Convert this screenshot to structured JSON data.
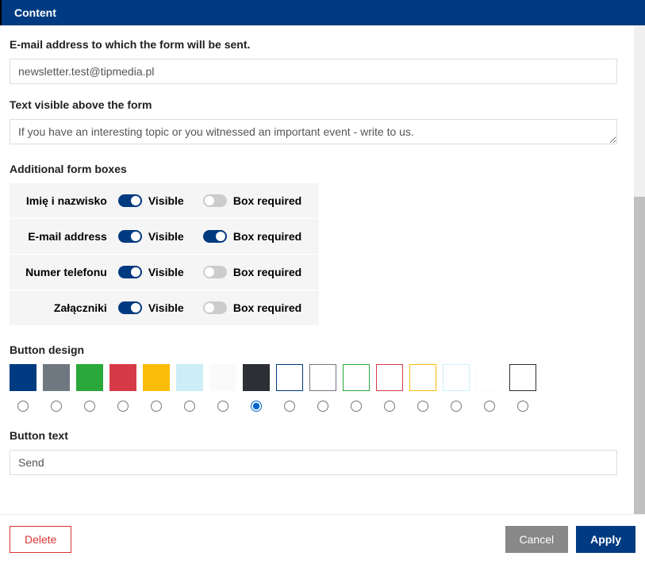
{
  "header": {
    "title": "Content"
  },
  "email_field": {
    "label": "E-mail address to which the form will be sent.",
    "value": "newsletter.test@tipmedia.pl"
  },
  "text_above": {
    "label": "Text visible above the form",
    "value": "If you have an interesting topic or you witnessed an important event - write to us."
  },
  "form_boxes": {
    "label": "Additional form boxes",
    "visible_label": "Visible",
    "required_label": "Box required",
    "rows": [
      {
        "name": "Imię i nazwisko",
        "visible": true,
        "required": false
      },
      {
        "name": "E-mail address",
        "visible": true,
        "required": true
      },
      {
        "name": "Numer telefonu",
        "visible": true,
        "required": false
      },
      {
        "name": "Załączniki",
        "visible": true,
        "required": false
      }
    ]
  },
  "button_design": {
    "label": "Button design",
    "selected_index": 7,
    "colors": [
      {
        "type": "solid",
        "color": "#003a80"
      },
      {
        "type": "solid",
        "color": "#6f7880"
      },
      {
        "type": "solid",
        "color": "#2aa839"
      },
      {
        "type": "solid",
        "color": "#d63a48"
      },
      {
        "type": "solid",
        "color": "#fbbd0a"
      },
      {
        "type": "solid",
        "color": "#cdeef7"
      },
      {
        "type": "solid",
        "color": "#fafafa"
      },
      {
        "type": "solid",
        "color": "#2c2f33"
      },
      {
        "type": "outlined",
        "color": "#003a80"
      },
      {
        "type": "outlined",
        "color": "#6f7880"
      },
      {
        "type": "outlined",
        "color": "#2aa839"
      },
      {
        "type": "outlined",
        "color": "#d63a48"
      },
      {
        "type": "outlined",
        "color": "#fbbd0a"
      },
      {
        "type": "outlined",
        "color": "#cdeef7"
      },
      {
        "type": "outlined",
        "color": "#fafafa"
      },
      {
        "type": "outlined",
        "color": "#2c2f33"
      }
    ]
  },
  "button_text": {
    "label": "Button text",
    "value": "Send"
  },
  "footer": {
    "delete": "Delete",
    "cancel": "Cancel",
    "apply": "Apply"
  }
}
